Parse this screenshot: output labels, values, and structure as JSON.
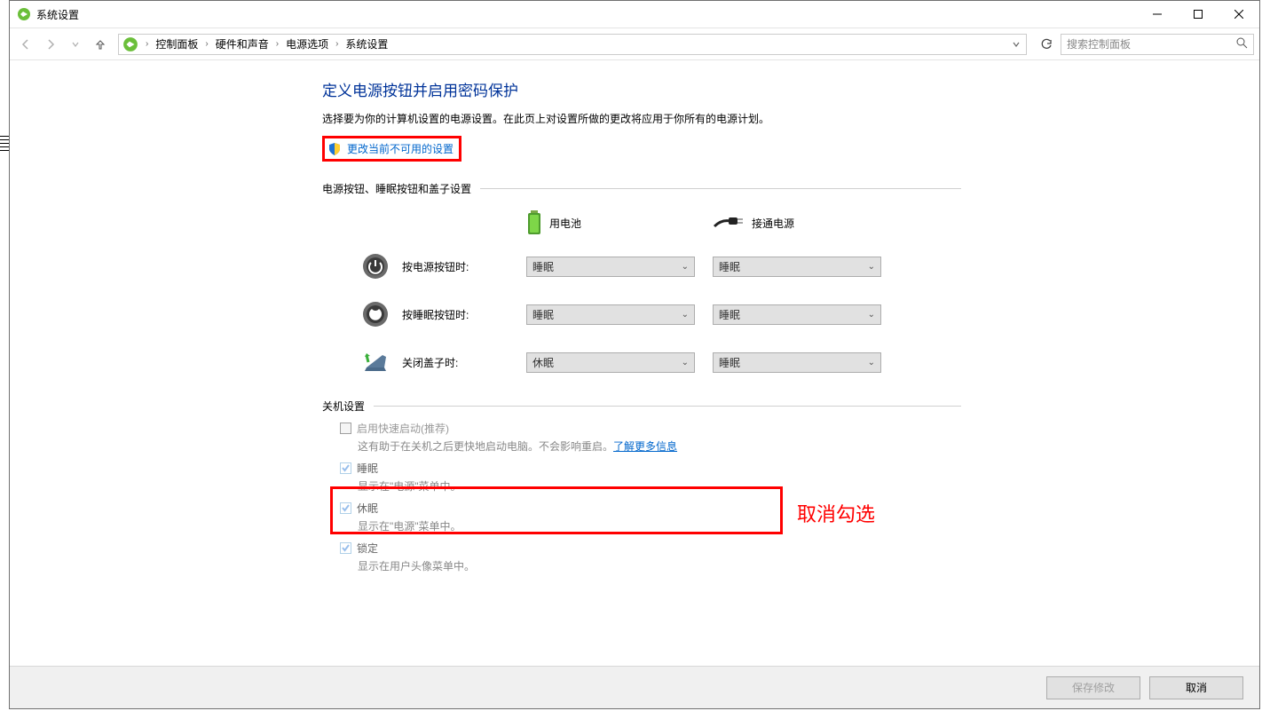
{
  "window": {
    "title": "系统设置"
  },
  "breadcrumb": {
    "items": [
      "控制面板",
      "硬件和声音",
      "电源选项",
      "系统设置"
    ]
  },
  "search": {
    "placeholder": "搜索控制面板"
  },
  "page": {
    "heading": "定义电源按钮并启用密码保护",
    "desc": "选择要为你的计算机设置的电源设置。在此页上对设置所做的更改将应用于你所有的电源计划。",
    "change_link": "更改当前不可用的设置"
  },
  "sections": {
    "buttons": "电源按钮、睡眠按钮和盖子设置",
    "shutdown": "关机设置"
  },
  "columns": {
    "battery": "用电池",
    "plugged": "接通电源"
  },
  "rows": {
    "power": {
      "label": "按电源按钮时:",
      "battery": "睡眠",
      "plugged": "睡眠"
    },
    "sleep": {
      "label": "按睡眠按钮时:",
      "battery": "睡眠",
      "plugged": "睡眠"
    },
    "lid": {
      "label": "关闭盖子时:",
      "battery": "休眠",
      "plugged": "睡眠"
    }
  },
  "shutdown": {
    "fast": {
      "title": "启用快速启动(推荐)",
      "sub_a": "这有助于在关机之后更快地启动电脑。不会影响重启。",
      "learn": "了解更多信息"
    },
    "sleep": {
      "title": "睡眠",
      "sub": "显示在\"电源\"菜单中。"
    },
    "hib": {
      "title": "休眠",
      "sub": "显示在\"电源\"菜单中。"
    },
    "lock": {
      "title": "锁定",
      "sub": "显示在用户头像菜单中。"
    }
  },
  "annotation": "取消勾选",
  "footer": {
    "save": "保存修改",
    "cancel": "取消"
  }
}
